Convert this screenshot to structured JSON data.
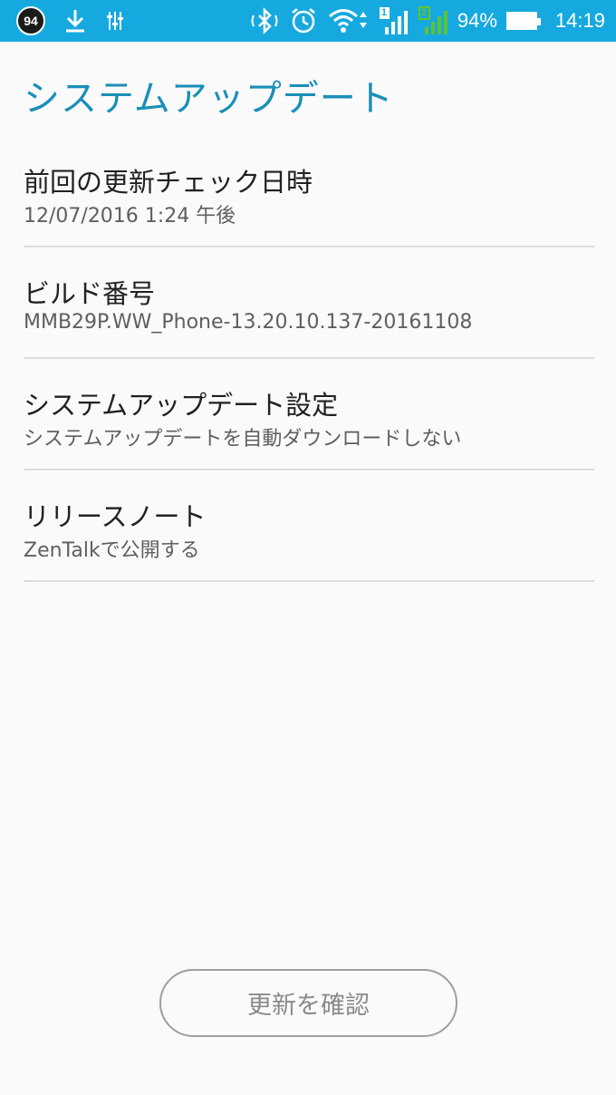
{
  "status_bar": {
    "notification_badge": "94",
    "icons_left": [
      "download-icon",
      "equalizer-icon"
    ],
    "icons_right": [
      "bluetooth-icon",
      "alarm-icon",
      "wifi-icon",
      "signal-sim1-icon",
      "signal-sim2-icon"
    ],
    "sim1_label": "1",
    "sim2_label": "2",
    "battery_percent": "94%",
    "time": "14:19",
    "bar_color": "#16a9df"
  },
  "page": {
    "title": "システムアップデート",
    "title_color": "#1a8fb8"
  },
  "settings": {
    "items": [
      {
        "title": "前回の更新チェック日時",
        "subtitle": "12/07/2016 1:24 午後"
      },
      {
        "title": "ビルド番号",
        "subtitle": "MMB29P.WW_Phone-13.20.10.137-20161108"
      },
      {
        "title": "システムアップデート設定",
        "subtitle": "システムアップデートを自動ダウンロードしない"
      },
      {
        "title": "リリースノート",
        "subtitle": "ZenTalkで公開する"
      }
    ]
  },
  "actions": {
    "check_update_label": "更新を確認"
  }
}
